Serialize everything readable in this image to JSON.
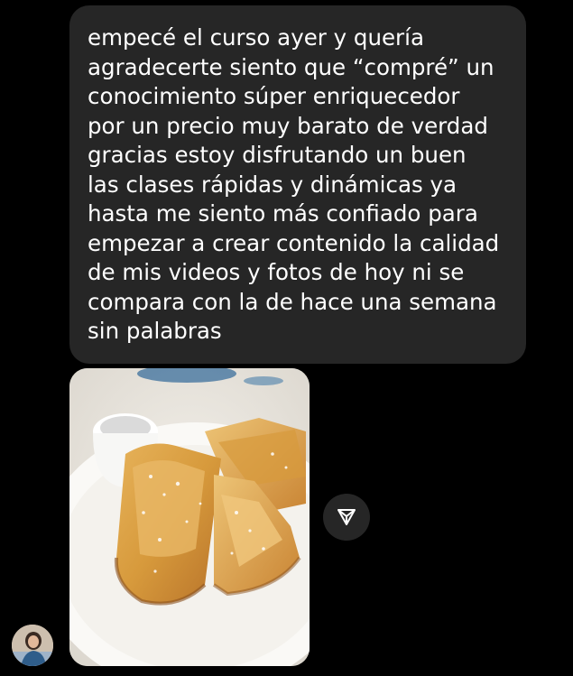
{
  "message": {
    "text": "empecé el curso ayer y quería\nagradecerte siento que “compré” un\nconocimiento súper enriquecedor\npor un precio muy barato de verdad\ngracias estoy disfrutando un buen\nlas clases rápidas y dinámicas ya\nhasta me siento más confiado para\nempezar a crear contenido la calidad\nde mis videos y fotos de hoy ni se\ncompara con la de hace una semana\nsin palabras"
  },
  "attachment": {
    "icon": "photo-french-toast"
  },
  "actions": {
    "share_icon": "send-arrow-icon"
  },
  "sender": {
    "avatar_icon": "avatar"
  },
  "colors": {
    "background": "#000000",
    "bubble": "#262626",
    "text": "#ffffff",
    "share_button": "#262626"
  }
}
